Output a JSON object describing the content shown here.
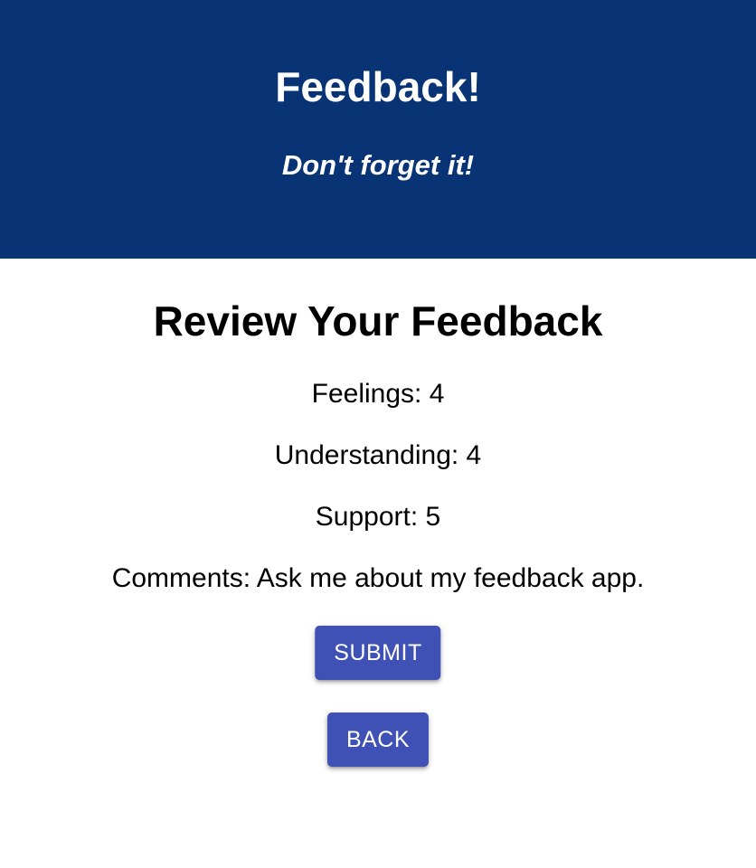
{
  "header": {
    "title": "Feedback!",
    "tagline": "Don't forget it!"
  },
  "review": {
    "heading": "Review Your Feedback",
    "feelings": "Feelings: 4",
    "understanding": "Understanding: 4",
    "support": "Support: 5",
    "comments": "Comments: Ask me about my feedback app."
  },
  "actions": {
    "submit_label": "SUBMIT",
    "back_label": "BACK"
  },
  "colors": {
    "header_bg": "#083375",
    "button_bg": "#3f51b5"
  }
}
